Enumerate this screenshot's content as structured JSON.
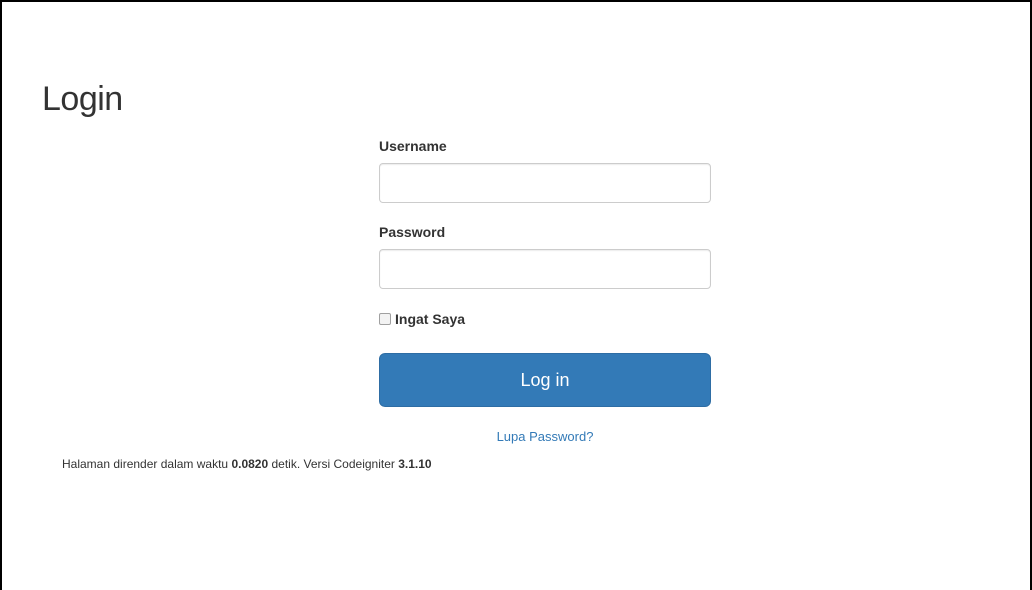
{
  "page": {
    "title": "Login"
  },
  "form": {
    "username_label": "Username",
    "username_value": "",
    "password_label": "Password",
    "password_value": "",
    "remember_label": "Ingat Saya",
    "remember_checked": false,
    "login_button_label": "Log in",
    "forgot_link": "Lupa Password?"
  },
  "footer": {
    "prefix": "Halaman dirender dalam waktu",
    "render_time": "0.0820",
    "middle": "detik. Versi Codeigniter",
    "version": "3.1.10"
  },
  "colors": {
    "primary": "#337ab7",
    "text": "#333333",
    "input_border": "#cccccc"
  }
}
